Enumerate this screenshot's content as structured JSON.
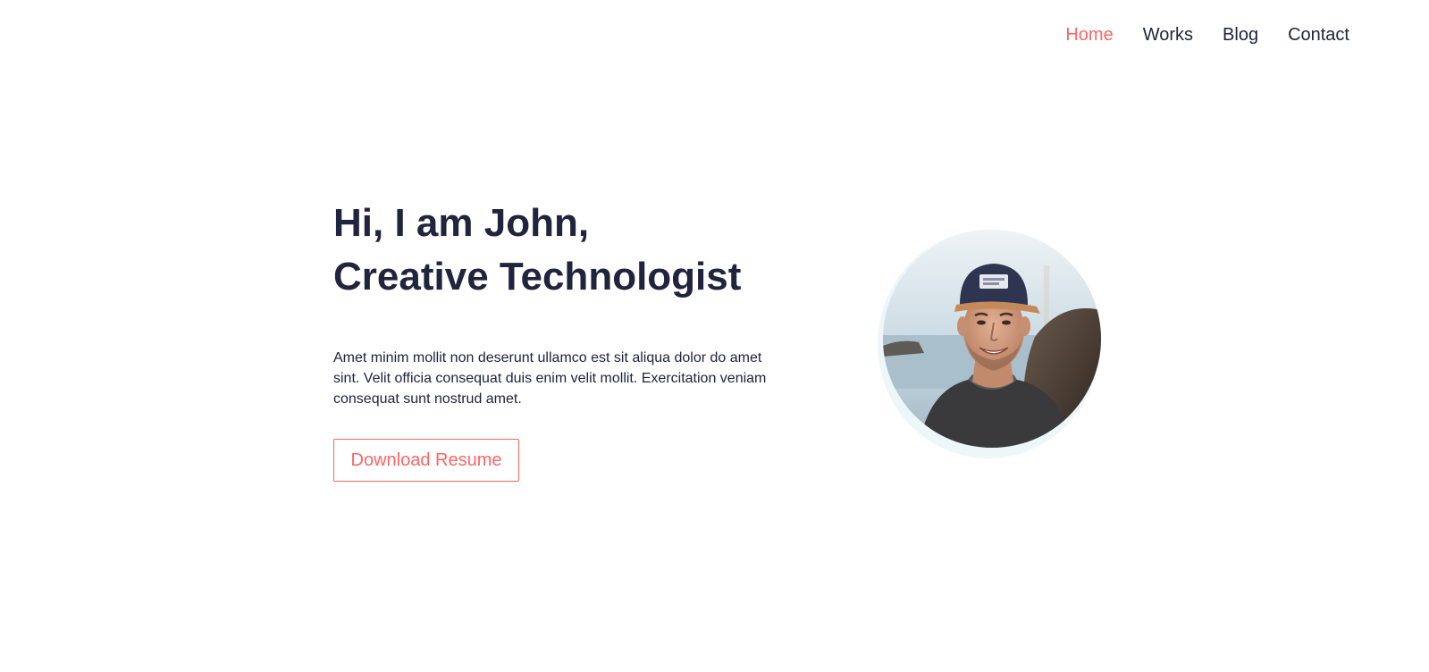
{
  "nav": {
    "items": [
      {
        "label": "Home",
        "active": true
      },
      {
        "label": "Works",
        "active": false
      },
      {
        "label": "Blog",
        "active": false
      },
      {
        "label": "Contact",
        "active": false
      }
    ]
  },
  "hero": {
    "title_line1": "Hi, I am John,",
    "title_line2": "Creative Technologist",
    "description": "Amet minim mollit non deserunt ullamco est sit aliqua dolor do amet sint. Velit officia consequat duis enim velit mollit. Exercitation veniam consequat sunt nostrud amet.",
    "button_label": "Download Resume"
  },
  "colors": {
    "accent": "#ff6464",
    "text": "#21243d",
    "avatar_ring": "#edf7fa"
  }
}
